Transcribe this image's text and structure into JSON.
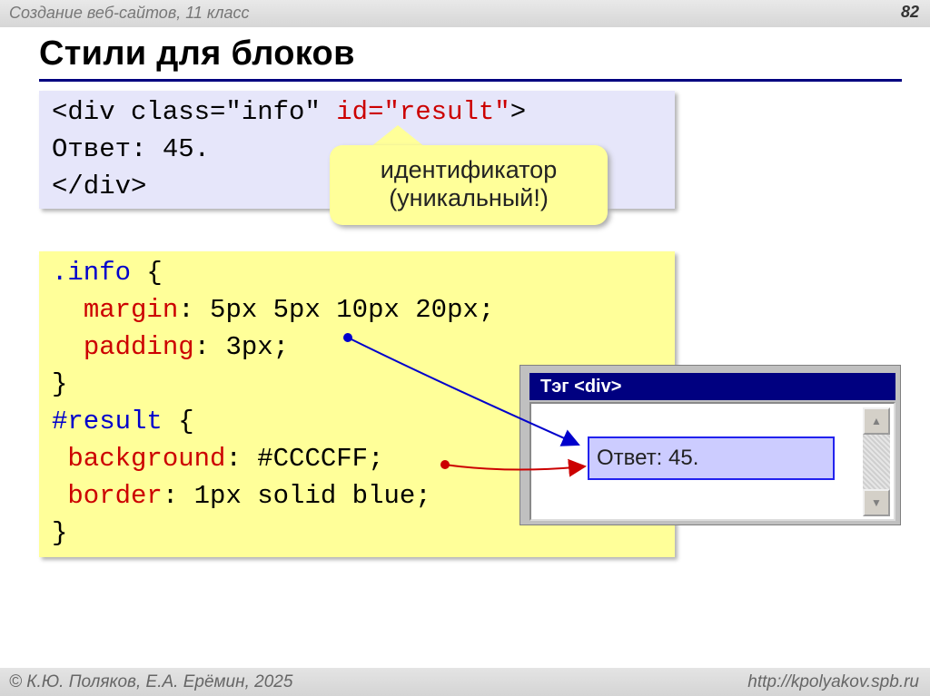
{
  "header": {
    "course": "Создание веб-сайтов, 11 класс",
    "page_number": "82"
  },
  "slide": {
    "title": "Стили для блоков"
  },
  "html_code": {
    "line1": {
      "open": "<div ",
      "class_attr": "class=\"info\" ",
      "id_attr": "id=\"result\"",
      "close": ">"
    },
    "line2": "Ответ: 45.",
    "line3": "</div>"
  },
  "callout": {
    "line1": "идентификатор",
    "line2": "(уникальный!)"
  },
  "css_code": {
    "info_selector": ".info",
    "brace_open": " {",
    "margin_prop": "margin",
    "margin_value": ": 5px 5px 10px 20px;",
    "padding_prop": "padding",
    "padding_value": ": 3px;",
    "brace_close": "}",
    "result_selector": "#result",
    "background_prop": "background",
    "background_value": ": #CCCCFF;",
    "border_prop": "border",
    "border_value": ": 1px solid blue;"
  },
  "browser_preview": {
    "title": "Тэг <div>",
    "result_text": "Ответ: 45."
  },
  "footer": {
    "authors": "© К.Ю. Поляков, Е.А. Ерёмин, 2025",
    "url": "http://kpolyakov.spb.ru"
  },
  "colors": {
    "title_rule": "#000080",
    "html_block_bg": "#E6E6FA",
    "css_block_bg": "#FFFF99",
    "keyword": "#CC0000",
    "selector": "#0000CC",
    "result_bg": "#CCCCFF",
    "arrow_blue": "#0000CC",
    "arrow_red": "#CC0000"
  },
  "icons": [
    "scroll-up-icon",
    "scroll-down-icon"
  ]
}
